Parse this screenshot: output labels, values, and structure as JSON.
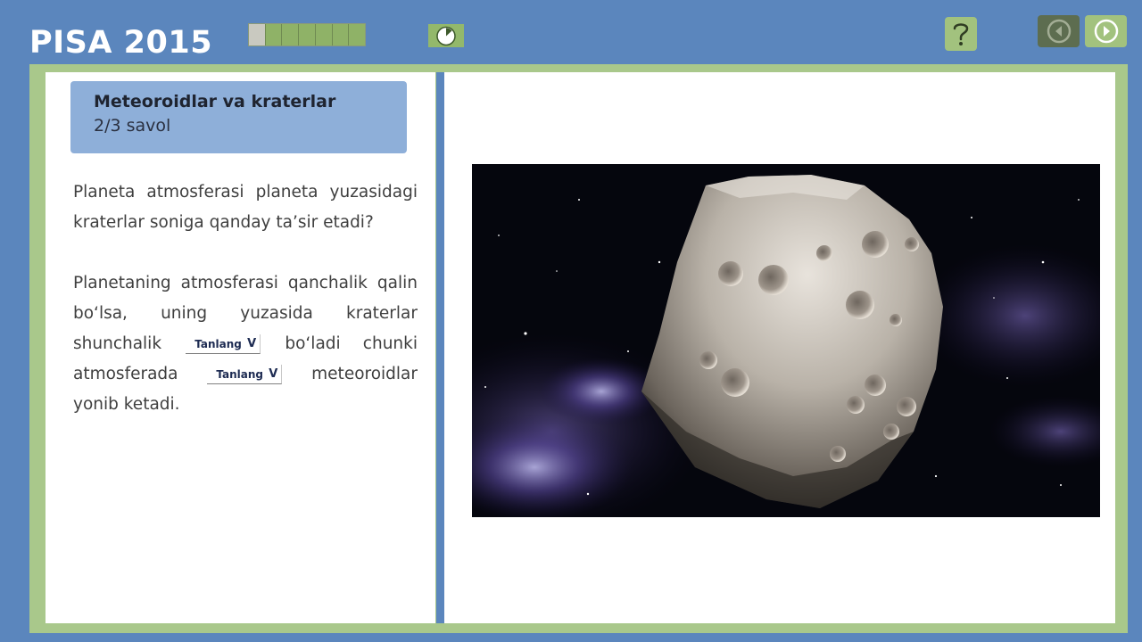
{
  "header": {
    "brand": "PISA 2015",
    "progress": {
      "completed_fraction": 0.14,
      "segments": 7
    },
    "timer_icon": "stopwatch-icon",
    "help_icon": "question-mark-icon",
    "prev_icon": "arrow-left-circle-icon",
    "next_icon": "arrow-right-circle-icon"
  },
  "colors": {
    "background": "#5b86bd",
    "frame": "#a9c88b",
    "accent_green": "#a2c27e",
    "question_box": "#8eafd9",
    "dropdown_text": "#1d2b52"
  },
  "question": {
    "unit_title": "Meteoroidlar va kraterlar",
    "counter": "2/3 savol",
    "prompt": "Planeta atmosferasi planeta yuzasidagi kraterlar soniga qanday ta’sir etadi?",
    "answer_part1": "Planetaning atmosferasi qanchalik qalin bo‘lsa, uning yuzasida kraterlar shunchalik",
    "answer_part2": "bo‘ladi chunki atmosferada",
    "answer_part3": "meteoroidlar yonib ketadi.",
    "dropdown1": {
      "selected": "Tanlang",
      "chevron": "V"
    },
    "dropdown2": {
      "selected": "Tanlang",
      "chevron": "V"
    }
  }
}
